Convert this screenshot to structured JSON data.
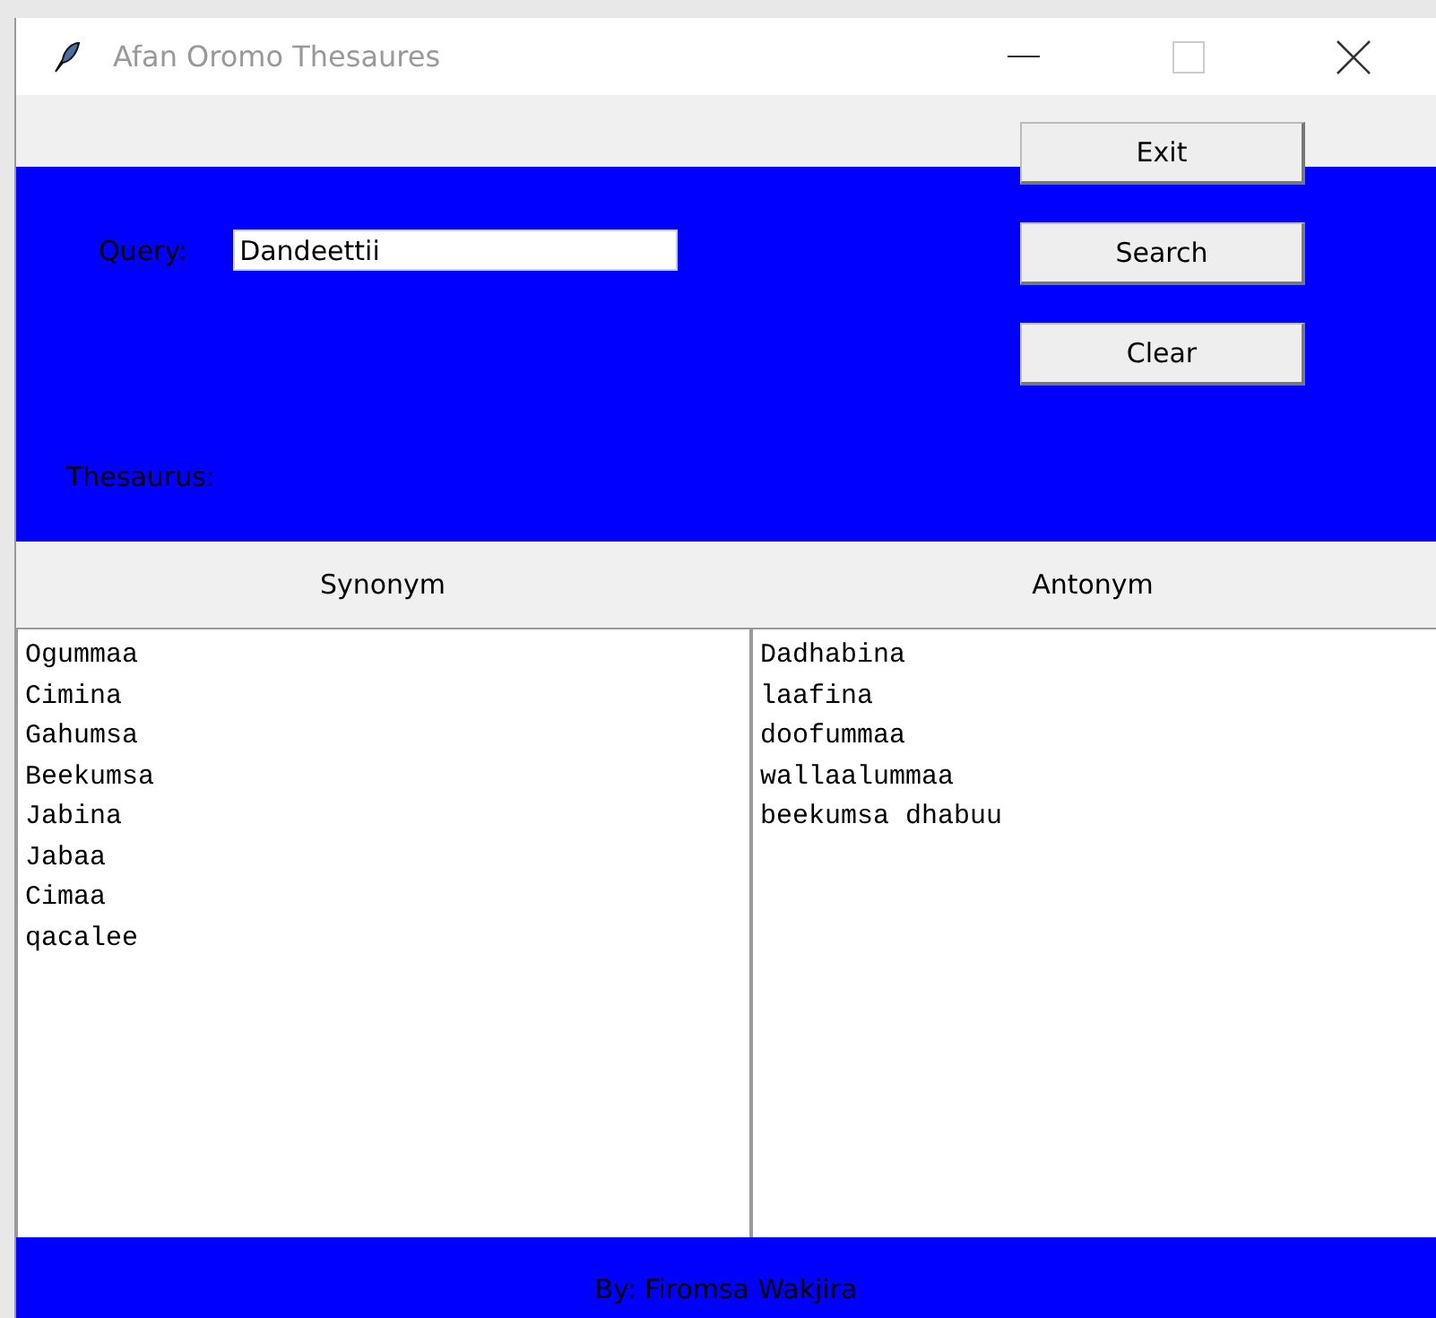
{
  "window": {
    "title": "Afan Oromo Thesaures"
  },
  "query": {
    "label": "Query:",
    "value": "Dandeettii"
  },
  "buttons": [
    "Exit",
    "Search",
    "Clear"
  ],
  "thesaurus_label": "Thesaurus:",
  "columns": [
    "Synonym",
    "Antonym"
  ],
  "synonyms": [
    "Ogummaa",
    "Cimina",
    "Gahumsa",
    "Beekumsa",
    "Jabina",
    "Jabaa",
    "Cimaa",
    "qacalee"
  ],
  "antonyms": [
    "Dadhabina",
    "laafina",
    "doofummaa",
    "wallaalummaa",
    "beekumsa dhabuu"
  ],
  "footer": "By: Firomsa Wakjira"
}
